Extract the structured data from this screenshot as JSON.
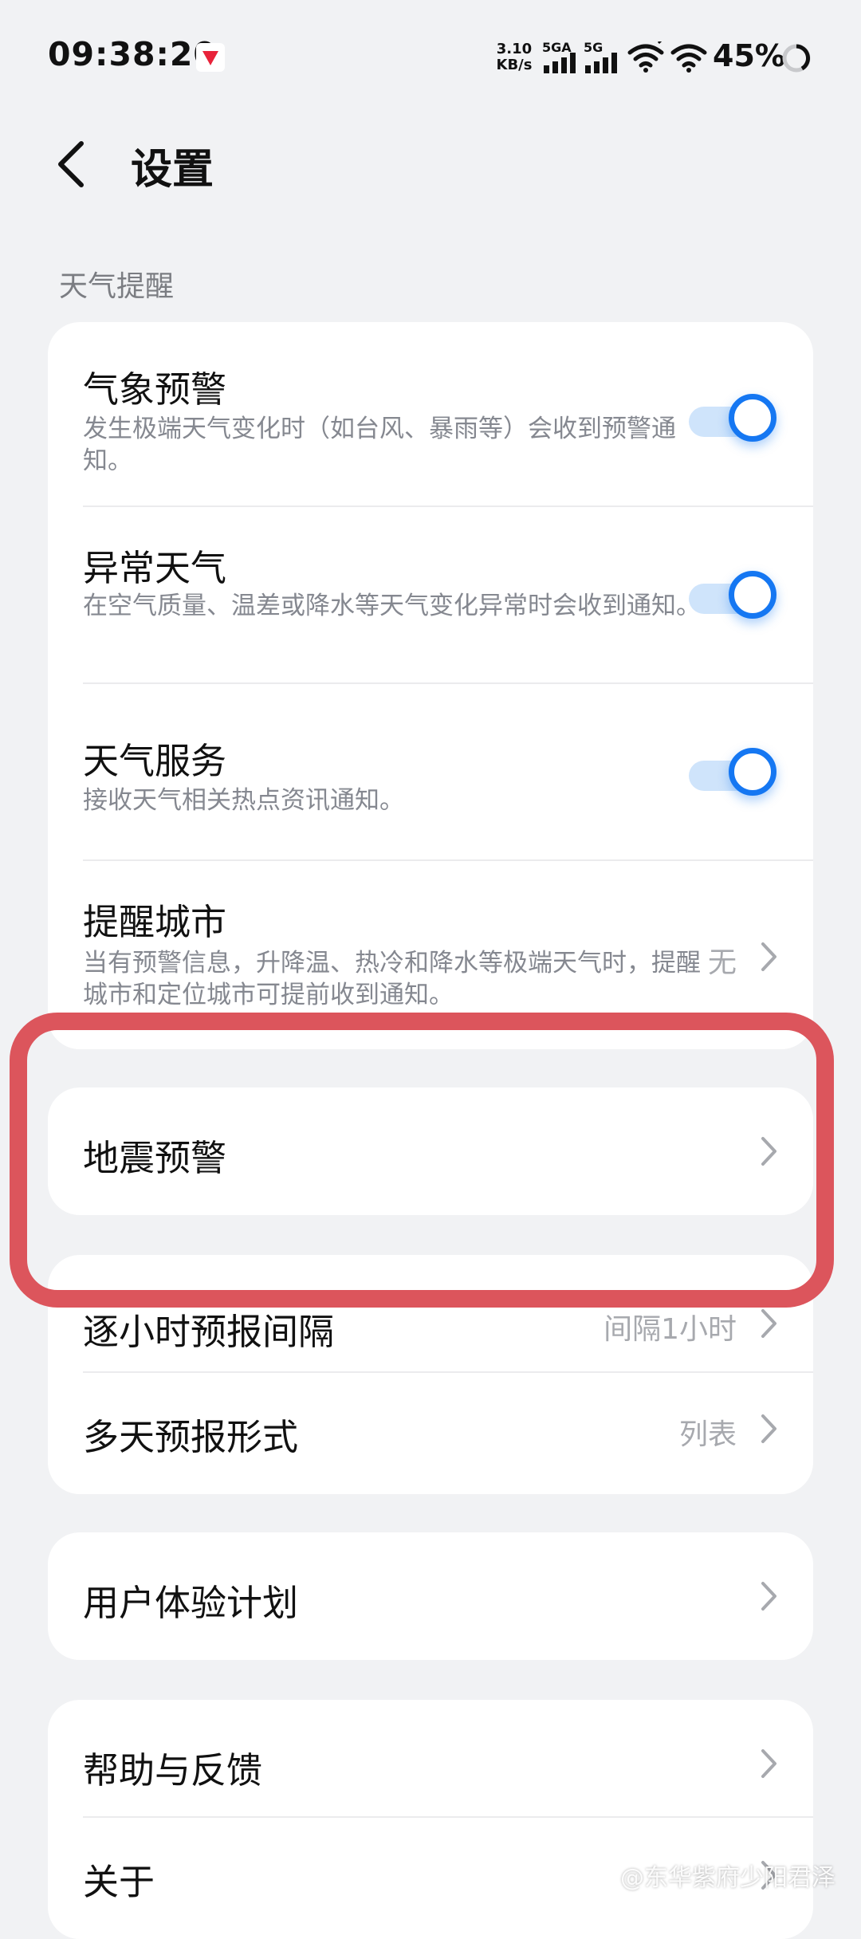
{
  "status_bar": {
    "time": "09:38:20",
    "net_speed_value": "3.10",
    "net_speed_unit": "KB/s",
    "signal1_label": "5GA",
    "signal2_label": "5G",
    "battery_percent": "45%"
  },
  "header": {
    "title": "设置"
  },
  "weather_alerts": {
    "section_title": "天气提醒",
    "items": [
      {
        "title": "气象预警",
        "desc": "发生极端天气变化时（如台风、暴雨等）会收到预警通知。",
        "toggle": "on"
      },
      {
        "title": "异常天气",
        "desc": "在空气质量、温差或降水等天气变化异常时会收到通知。",
        "toggle": "on"
      },
      {
        "title": "天气服务",
        "desc": "接收天气相关热点资讯通知。",
        "toggle": "on"
      },
      {
        "title": "提醒城市",
        "desc": "当有预警信息，升降温、热冷和降水等极端天气时，提醒城市和定位城市可提前收到通知。",
        "value": "无"
      }
    ]
  },
  "earthquake": {
    "title": "地震预警"
  },
  "forecast": {
    "items": [
      {
        "title": "逐小时预报间隔",
        "value": "间隔1小时"
      },
      {
        "title": "多天预报形式",
        "value": "列表"
      }
    ]
  },
  "experience": {
    "title": "用户体验计划"
  },
  "help": {
    "items": [
      {
        "title": "帮助与反馈"
      },
      {
        "title": "关于"
      }
    ]
  },
  "watermark": "@东华紫府少阳君泽",
  "colors": {
    "accent": "#1577f2",
    "highlight": "#dc555c",
    "background": "#f1f2f4"
  }
}
